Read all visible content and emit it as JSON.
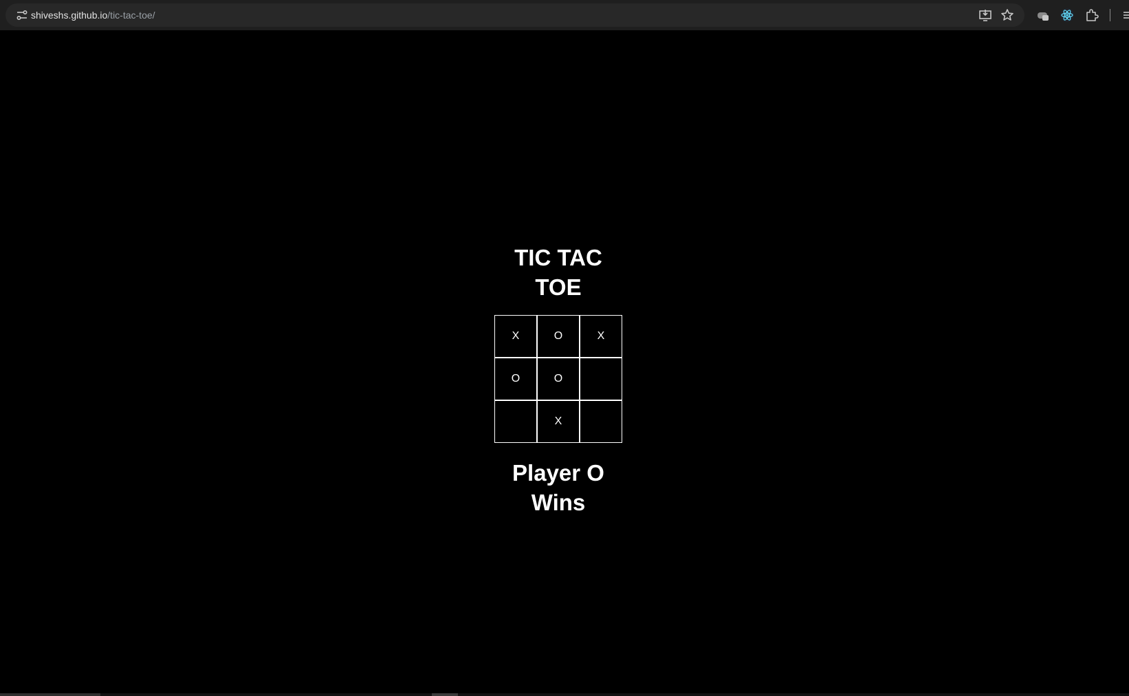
{
  "browser": {
    "url_host": "shiveshs.github.io",
    "url_path": "/tic-tac-toe/",
    "icons": [
      "site-settings-icon",
      "install-app-icon",
      "bookmark-star-icon",
      "extension-gamepad-icon",
      "react-devtools-icon",
      "extensions-puzzle-icon",
      "menu-icon"
    ]
  },
  "game": {
    "title_line1": "TIC TAC",
    "title_line2": "TOE",
    "board": [
      [
        "X",
        "O",
        "X"
      ],
      [
        "O",
        "O",
        ""
      ],
      [
        "",
        "X",
        ""
      ]
    ],
    "status_line1": "Player O",
    "status_line2": "Wins"
  },
  "colors": {
    "background": "#000000",
    "foreground": "#ffffff",
    "toolbar": "#1f1f1f",
    "omnibox": "#282828"
  }
}
